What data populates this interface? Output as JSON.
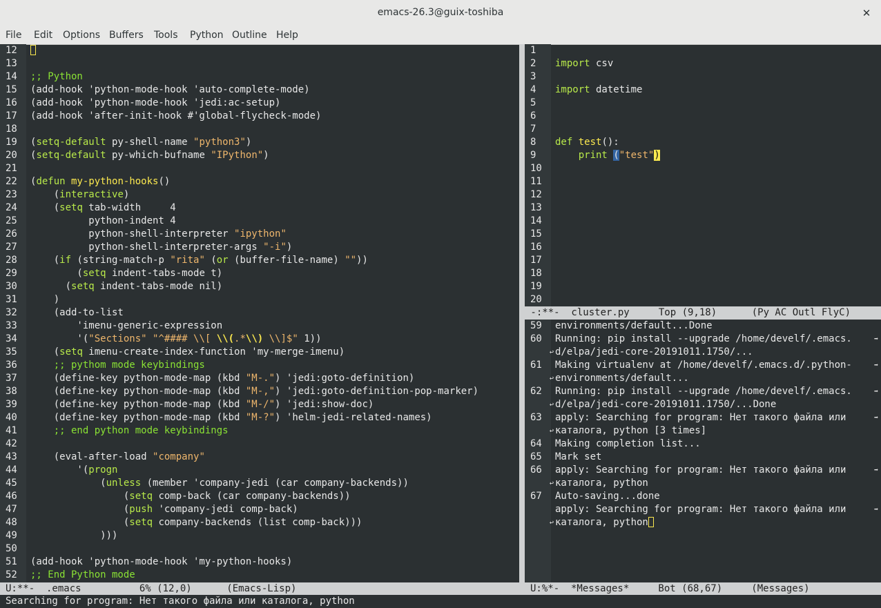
{
  "window": {
    "title": "emacs-26.3@guix-toshiba",
    "close_glyph": "✕"
  },
  "menu": [
    "File",
    "Edit",
    "Options",
    "Buffers",
    "Tools",
    "Python",
    "Outline",
    "Help"
  ],
  "left_buffer": {
    "line_numbers": [
      "12",
      "13",
      "14",
      "15",
      "16",
      "17",
      "18",
      "19",
      "20",
      "21",
      "22",
      "23",
      "24",
      "25",
      "26",
      "27",
      "28",
      "29",
      "30",
      "31",
      "32",
      "33",
      "34",
      "35",
      "36",
      "37",
      "38",
      "39",
      "40",
      "41",
      "42",
      "43",
      "44",
      "45",
      "46",
      "47",
      "48",
      "49",
      "50",
      "51",
      "52"
    ],
    "lines": [
      "",
      "",
      ";; Python",
      "(add-hook 'python-mode-hook 'auto-complete-mode)",
      "(add-hook 'python-mode-hook 'jedi:ac-setup)",
      "(add-hook 'after-init-hook #'global-flycheck-mode)",
      "",
      "(setq-default py-shell-name \"python3\")",
      "(setq-default py-which-bufname \"IPython\")",
      "",
      "(defun my-python-hooks()",
      "    (interactive)",
      "    (setq tab-width     4",
      "          python-indent 4",
      "          python-shell-interpreter \"ipython\"",
      "          python-shell-interpreter-args \"-i\")",
      "    (if (string-match-p \"rita\" (or (buffer-file-name) \"\"))",
      "        (setq indent-tabs-mode t)",
      "      (setq indent-tabs-mode nil)",
      "    )",
      "    (add-to-list",
      "        'imenu-generic-expression",
      "        '(\"Sections\" \"^#### \\\\[ \\\\(.*\\\\) \\\\]$\" 1))",
      "    (setq imenu-create-index-function 'my-merge-imenu)",
      "    ;; pythom mode keybindings",
      "    (define-key python-mode-map (kbd \"M-.\") 'jedi:goto-definition)",
      "    (define-key python-mode-map (kbd \"M-,\") 'jedi:goto-definition-pop-marker)",
      "    (define-key python-mode-map (kbd \"M-/\") 'jedi:show-doc)",
      "    (define-key python-mode-map (kbd \"M-?\") 'helm-jedi-related-names)",
      "    ;; end python mode keybindings",
      "",
      "    (eval-after-load \"company\"",
      "        '(progn",
      "            (unless (member 'company-jedi (car company-backends))",
      "                (setq comp-back (car company-backends))",
      "                (push 'company-jedi comp-back)",
      "                (setq company-backends (list comp-back)))",
      "            )))",
      "",
      "(add-hook 'python-mode-hook 'my-python-hooks)",
      ";; End Python mode"
    ],
    "modeline": "U:**-  .emacs          6% (12,0)      (Emacs-Lisp)"
  },
  "right_top_buffer": {
    "line_numbers": [
      "1",
      "2",
      "3",
      "4",
      "5",
      "6",
      "7",
      "8",
      "9",
      "10",
      "11",
      "12",
      "13",
      "14",
      "15",
      "16",
      "17",
      "18",
      "19",
      "20"
    ],
    "lines": [
      "",
      "import csv",
      "",
      "import datetime",
      "",
      "",
      "",
      "def test():",
      "    print (\"test\")",
      "",
      "",
      "",
      "",
      "",
      "",
      "",
      "",
      "",
      "",
      ""
    ],
    "modeline": " -:**-  cluster.py     Top (9,18)      (Py AC Outl FlyC)"
  },
  "right_bottom_buffer": {
    "rows": [
      {
        "n": "59",
        "text": "environments/default...Done",
        "wrap_end": false,
        "wrap_start": false
      },
      {
        "n": "60",
        "text": "Running: pip install --upgrade /home/develf/.emacs.",
        "wrap_end": true,
        "wrap_start": false
      },
      {
        "n": "",
        "text": "d/elpa/jedi-core-20191011.1750/...",
        "wrap_end": false,
        "wrap_start": true
      },
      {
        "n": "61",
        "text": "Making virtualenv at /home/develf/.emacs.d/.python-",
        "wrap_end": true,
        "wrap_start": false
      },
      {
        "n": "",
        "text": "environments/default...",
        "wrap_end": false,
        "wrap_start": true
      },
      {
        "n": "62",
        "text": "Running: pip install --upgrade /home/develf/.emacs.",
        "wrap_end": true,
        "wrap_start": false
      },
      {
        "n": "",
        "text": "d/elpa/jedi-core-20191011.1750/...Done",
        "wrap_end": false,
        "wrap_start": true
      },
      {
        "n": "63",
        "text": "apply: Searching for program: Нет такого файла или",
        "wrap_end": true,
        "wrap_start": false
      },
      {
        "n": "",
        "text": "каталога, python [3 times]",
        "wrap_end": false,
        "wrap_start": true
      },
      {
        "n": "64",
        "text": "Making completion list...",
        "wrap_end": false,
        "wrap_start": false
      },
      {
        "n": "65",
        "text": "Mark set",
        "wrap_end": false,
        "wrap_start": false
      },
      {
        "n": "66",
        "text": "apply: Searching for program: Нет такого файла или",
        "wrap_end": true,
        "wrap_start": false
      },
      {
        "n": "",
        "text": "каталога, python",
        "wrap_end": false,
        "wrap_start": true
      },
      {
        "n": "67",
        "text": "Auto-saving...done",
        "wrap_end": false,
        "wrap_start": false
      },
      {
        "n": "",
        "text": "apply: Searching for program: Нет такого файла или",
        "wrap_end": true,
        "wrap_start": false
      },
      {
        "n": "",
        "text": "каталога, python",
        "wrap_end": false,
        "wrap_start": true
      }
    ],
    "modeline": "U:%*-  *Messages*     Bot (68,67)     (Messages)"
  },
  "echo_area": "Searching for program: Нет такого файла или каталога, python",
  "colors": {
    "background": "#2b3032",
    "comment": "#8ae234",
    "keyword": "#b8e94a",
    "string": "#eeb66c",
    "cursor": "#fce94f",
    "modeline": "#cfd1d2"
  }
}
